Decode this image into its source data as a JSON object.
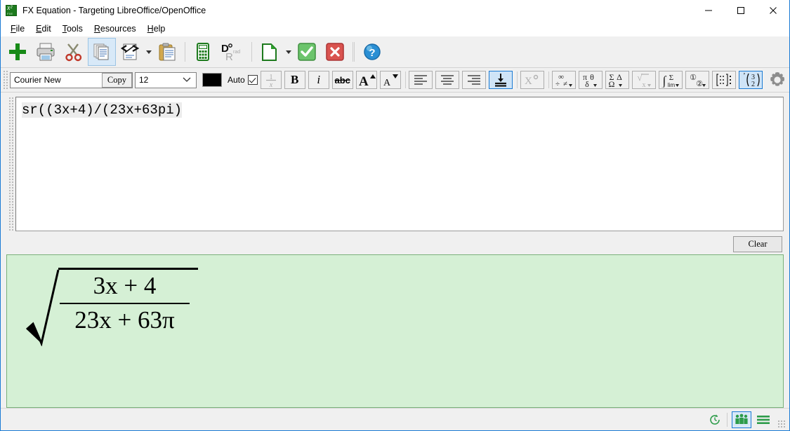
{
  "window": {
    "title": "FX Equation - Targeting LibreOffice/OpenOffice",
    "app_icon": "fx-equation-app-icon",
    "minimize_label": "─",
    "maximize_label": "□",
    "close_label": "✕"
  },
  "menubar": {
    "items": [
      {
        "label": "File",
        "accel": "F"
      },
      {
        "label": "Edit",
        "accel": "E"
      },
      {
        "label": "Tools",
        "accel": "T"
      },
      {
        "label": "Resources",
        "accel": "R"
      },
      {
        "label": "Help",
        "accel": "H"
      }
    ]
  },
  "toolbar": {
    "items": [
      {
        "name": "new-icon",
        "tip": "New"
      },
      {
        "name": "print-icon",
        "tip": "Print"
      },
      {
        "name": "cut-icon",
        "tip": "Cut"
      },
      {
        "name": "copy-icon",
        "tip": "Copy",
        "selected": true
      },
      {
        "name": "copy-as-code-icon",
        "tip": "Copy as code",
        "dropdown": true
      },
      {
        "name": "paste-icon",
        "tip": "Paste"
      },
      {
        "name": "calculator-icon",
        "tip": "Calculator"
      },
      {
        "name": "degrees-radians-icon",
        "tip": "Degrees / Radians",
        "deg": "D",
        "deg_sup": "°",
        "rad": "R",
        "rad_sup": "rad"
      },
      {
        "name": "libreoffice-doc-icon",
        "tip": "Send to LibreOffice",
        "dropdown": true
      },
      {
        "name": "accept-icon",
        "tip": "Accept"
      },
      {
        "name": "cancel-icon",
        "tip": "Cancel"
      },
      {
        "name": "help-icon",
        "tip": "Help"
      }
    ]
  },
  "format_bar": {
    "font_name": "Courier New",
    "copy_label": "Copy",
    "font_size": "12",
    "color_swatch": "#000000",
    "auto_label": "Auto",
    "auto_checked": true,
    "buttons": [
      {
        "name": "fraction-button",
        "label": "1/x",
        "disabled": true
      },
      {
        "name": "bold-button",
        "label": "B"
      },
      {
        "name": "italic-button",
        "label": "i"
      },
      {
        "name": "strikethrough-button",
        "label": "abc"
      },
      {
        "name": "increase-font-button",
        "label": "A▲"
      },
      {
        "name": "decrease-font-button",
        "label": "A▼"
      },
      {
        "name": "align-left-button",
        "label": "align-left"
      },
      {
        "name": "align-center-button",
        "label": "align-center"
      },
      {
        "name": "align-right-button",
        "label": "align-right"
      },
      {
        "name": "align-bottom-button",
        "label": "align-bottom",
        "selected": true
      },
      {
        "name": "superscript-button",
        "label": "X°",
        "disabled": true
      },
      {
        "name": "operators-palette-button",
        "label": "∞ ÷ ≠"
      },
      {
        "name": "greek-palette-button",
        "label": "π θ δ"
      },
      {
        "name": "sum-palette-button",
        "label": "Σ Ω Δ"
      },
      {
        "name": "root-palette-button",
        "label": "√x",
        "disabled": true
      },
      {
        "name": "integral-palette-button",
        "label": "∫ Σ lim"
      },
      {
        "name": "circled-number-button",
        "label": "① ②"
      },
      {
        "name": "matrix-button",
        "label": "matrix"
      },
      {
        "name": "binomial-button",
        "label": "(3 2)",
        "selected": true
      },
      {
        "name": "settings-gear-button",
        "label": "settings"
      }
    ]
  },
  "editor": {
    "value": "sr((3x+4)/(23x+63pi)",
    "clear_label": "Clear"
  },
  "preview": {
    "background": "#d5f0d5",
    "equation": {
      "kind": "square-root-of-fraction",
      "numerator": "3x + 4",
      "denominator": "23x + 63π"
    }
  },
  "statusbar": {
    "buttons": [
      {
        "name": "history-clock-icon",
        "selected": false
      },
      {
        "name": "people-group-icon",
        "selected": true
      },
      {
        "name": "menu-lines-icon",
        "selected": false
      }
    ]
  }
}
